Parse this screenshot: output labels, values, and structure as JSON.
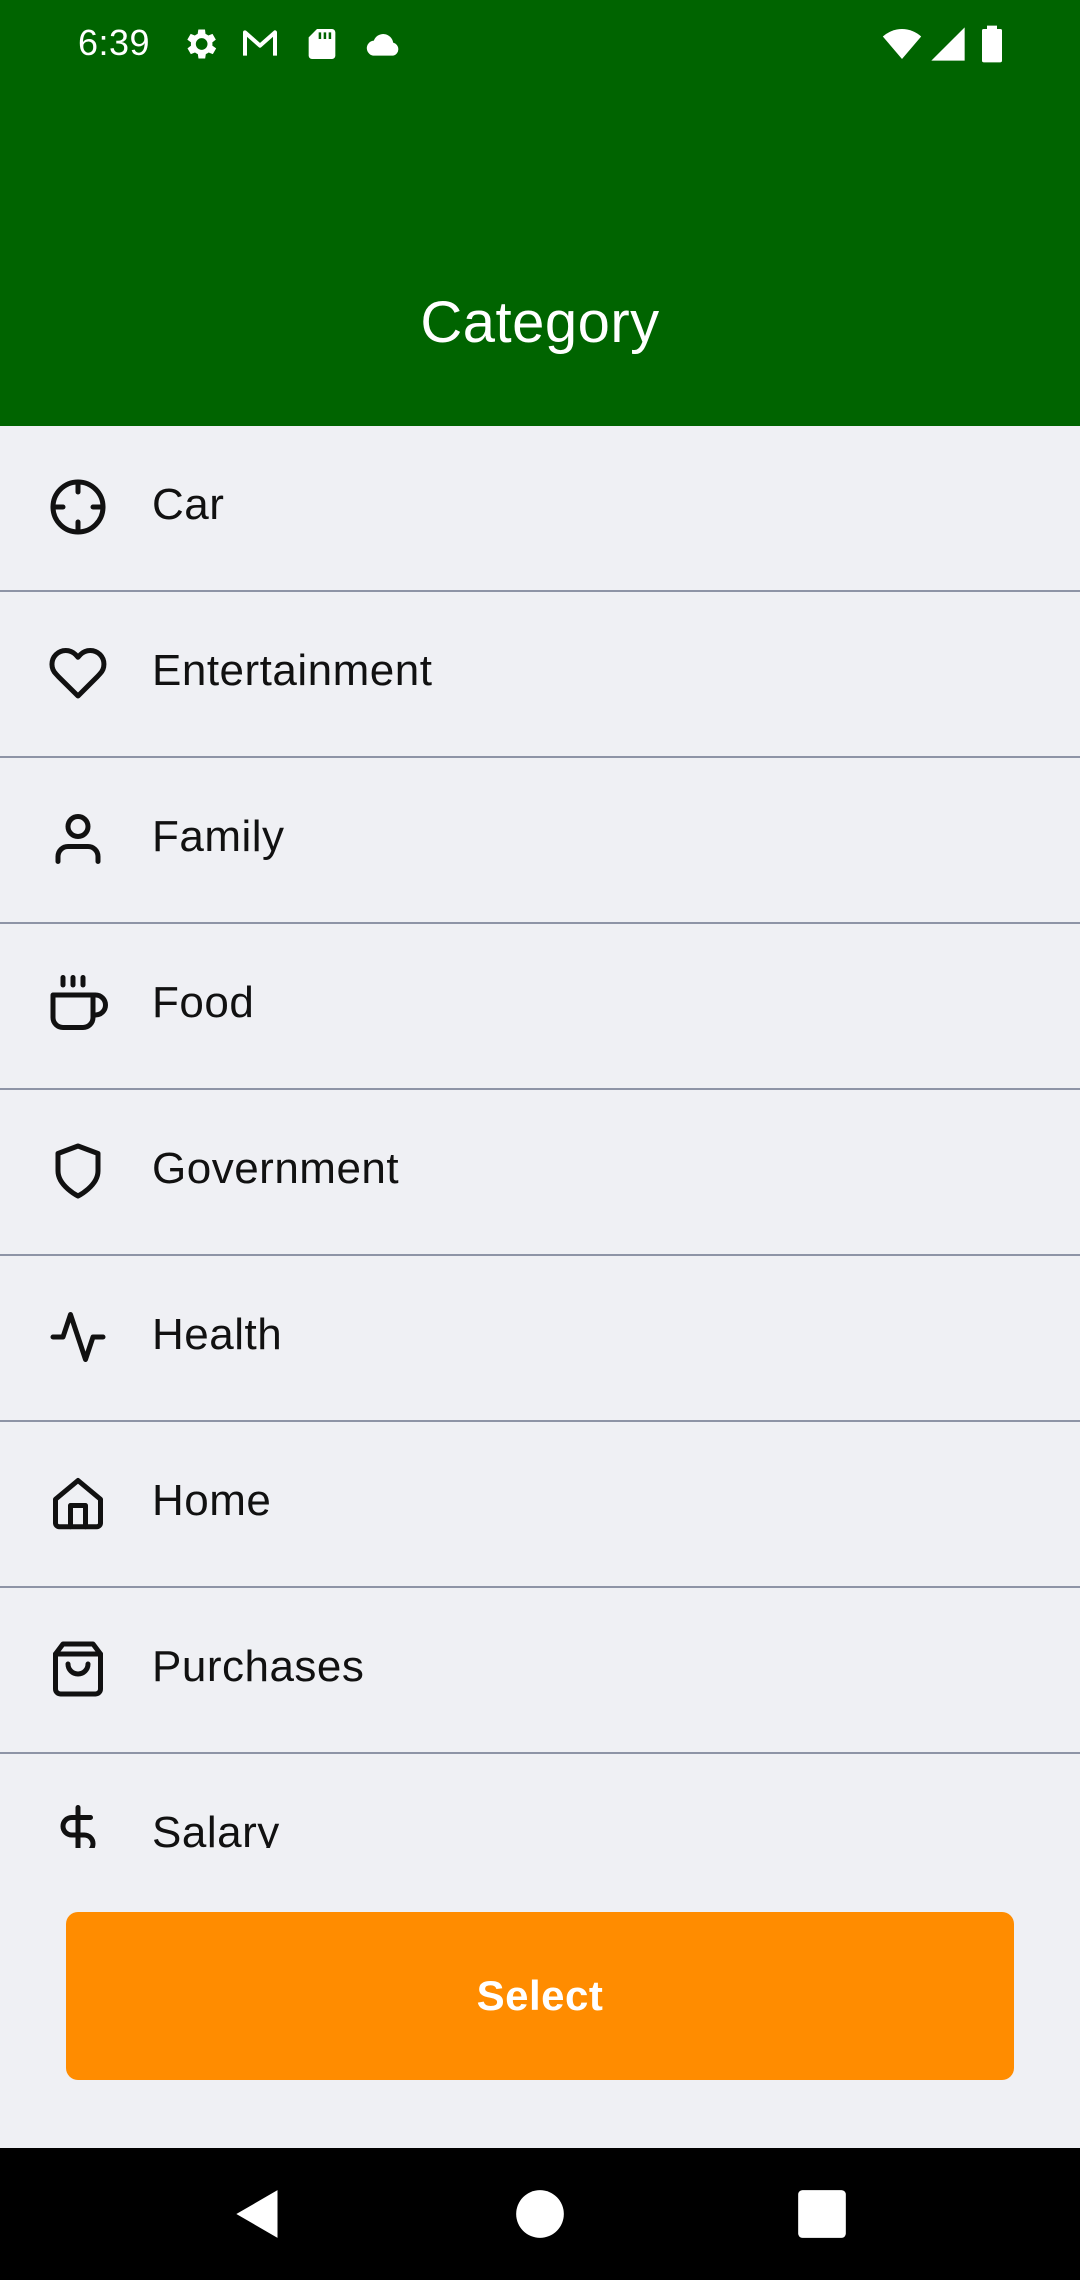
{
  "status_bar": {
    "time": "6:39",
    "left_icons": [
      "settings-icon",
      "gmail-icon",
      "sd-card-icon",
      "cloud-icon"
    ],
    "right_icons": [
      "wifi-icon",
      "signal-icon",
      "battery-icon"
    ]
  },
  "header": {
    "title": "Category",
    "background_color": "#006400"
  },
  "categories": [
    {
      "label": "Car",
      "icon": "crosshair-icon"
    },
    {
      "label": "Entertainment",
      "icon": "heart-icon"
    },
    {
      "label": "Family",
      "icon": "user-icon"
    },
    {
      "label": "Food",
      "icon": "coffee-icon"
    },
    {
      "label": "Government",
      "icon": "shield-icon"
    },
    {
      "label": "Health",
      "icon": "activity-icon"
    },
    {
      "label": "Home",
      "icon": "home-icon"
    },
    {
      "label": "Purchases",
      "icon": "shopping-bag-icon"
    },
    {
      "label": "Salary",
      "icon": "dollar-icon"
    }
  ],
  "select_button": {
    "label": "Select",
    "color": "#ff8c00"
  },
  "nav_bar": {
    "buttons": [
      "back-icon",
      "home-circle-icon",
      "recents-icon"
    ]
  }
}
